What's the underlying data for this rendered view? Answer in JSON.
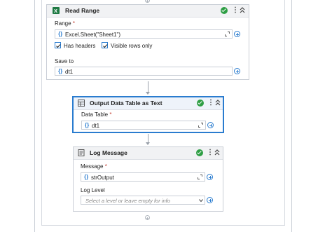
{
  "activities": {
    "read_range": {
      "title": "Read Range",
      "range_label": "Range",
      "range_value": "Excel.Sheet(\"Sheet1\")",
      "has_headers_label": "Has headers",
      "has_headers_checked": true,
      "visible_rows_label": "Visible rows only",
      "visible_rows_checked": true,
      "save_to_label": "Save to",
      "save_to_value": "dt1"
    },
    "output_data_table": {
      "title": "Output Data Table as Text",
      "data_table_label": "Data Table",
      "data_table_value": "dt1"
    },
    "log_message": {
      "title": "Log Message",
      "message_label": "Message",
      "message_value": "strOutput",
      "log_level_label": "Log Level",
      "log_level_placeholder": "Select a level or leave empty for info"
    }
  },
  "common": {
    "required_marker": "*",
    "brace_glyph": "{}",
    "kebab_glyph": "⋮"
  },
  "colors": {
    "accent": "#2a7ccf",
    "success": "#2e9e44",
    "excel_green": "#1f7a43"
  },
  "icons": [
    "excel-icon",
    "check-icon",
    "kebab-icon",
    "collapse-icon",
    "expand-icon",
    "add-variable-icon",
    "output-table-icon",
    "log-icon",
    "chevron-down-icon"
  ]
}
